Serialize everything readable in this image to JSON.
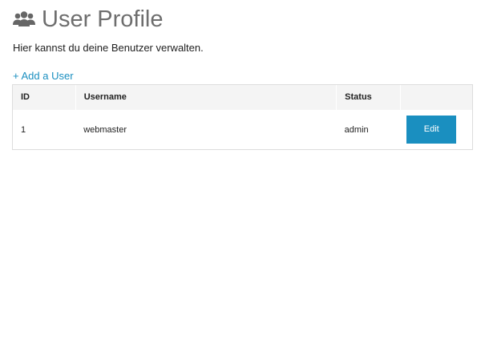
{
  "header": {
    "icon": "users-icon",
    "title": "User Profile"
  },
  "subtitle": "Hier kannst du deine Benutzer verwalten.",
  "actions": {
    "add_user_label": "+ Add a User"
  },
  "table": {
    "columns": [
      "ID",
      "Username",
      "Status",
      ""
    ],
    "rows": [
      {
        "id": "1",
        "username": "webmaster",
        "status": "admin",
        "action_label": "Edit"
      }
    ]
  },
  "colors": {
    "accent": "#1a8fc0",
    "title": "#6e6e6e",
    "header_row_bg": "#f4f4f4",
    "border": "#dddddd"
  }
}
